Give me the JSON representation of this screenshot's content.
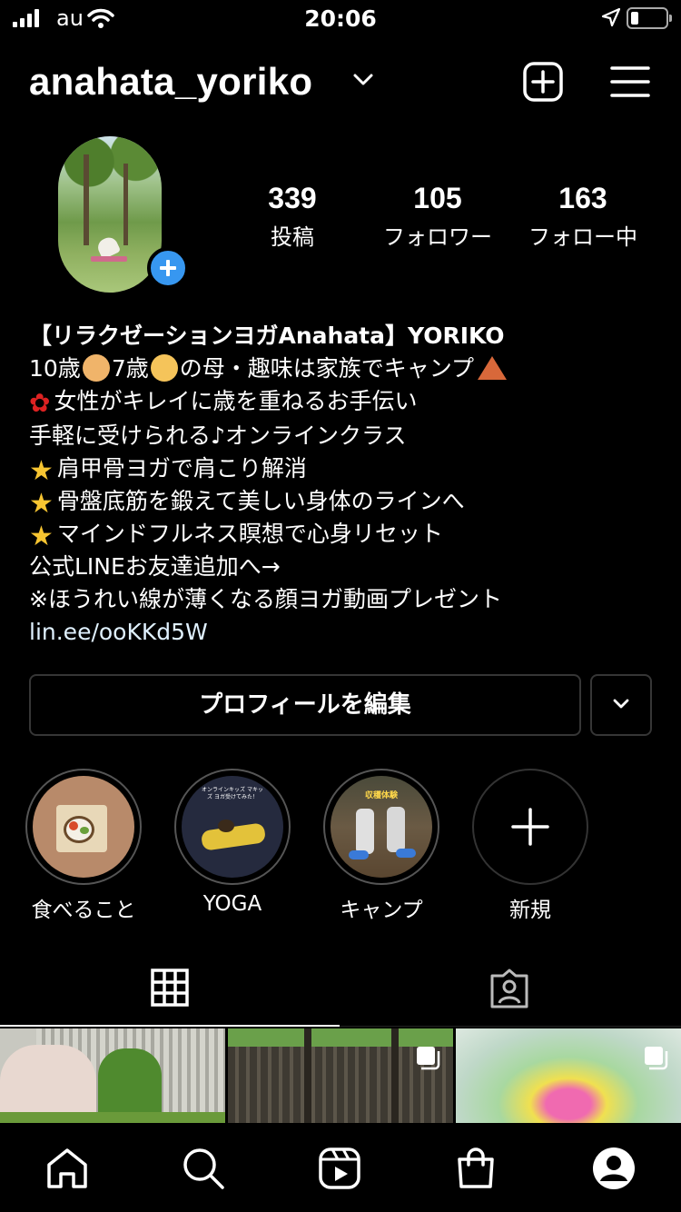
{
  "status_bar": {
    "carrier": "au",
    "time": "20:06"
  },
  "header": {
    "username": "anahata_yoriko"
  },
  "stats": [
    {
      "value": "339",
      "label": "投稿"
    },
    {
      "value": "105",
      "label": "フォロワー"
    },
    {
      "value": "163",
      "label": "フォロー中"
    }
  ],
  "bio": {
    "name": "【リラクゼーションヨガAnahata】YORIKO",
    "line1_a": "10歳",
    "line1_b": "7歳",
    "line1_c": "の母・趣味は家族でキャンプ",
    "line2": "女性がキレイに歳を重ねるお手伝い",
    "line3": "手軽に受けられる♪オンラインクラス",
    "line4": "肩甲骨ヨガで肩こり解消",
    "line5": "骨盤底筋を鍛えて美しい身体のラインへ",
    "line6": "マインドフルネス瞑想で心身リセット",
    "line7": "公式LINEお友達追加へ→",
    "line8": "※ほうれい線が薄くなる顔ヨガ動画プレゼント",
    "link": "lin.ee/ooKKd5W"
  },
  "buttons": {
    "edit_profile": "プロフィールを編集"
  },
  "highlights": [
    {
      "label": "食べること"
    },
    {
      "label": "YOGA",
      "thumb_text": "オンラインキッズ マキッズ ヨガ受けてみた！"
    },
    {
      "label": "キャンプ",
      "thumb_text": "収穫体験"
    },
    {
      "label": "新規"
    }
  ],
  "tabs": {
    "active": "grid"
  },
  "bottom_nav": {
    "active": "profile"
  },
  "colors": {
    "background": "#000000",
    "accent_blue": "#3797f0",
    "border": "#363636",
    "link": "#e0f1ff"
  },
  "icons": [
    "signal-icon",
    "wifi-icon",
    "location-arrow-icon",
    "battery-icon",
    "chevron-down-icon",
    "new-post-icon",
    "hamburger-menu-icon",
    "plus-icon",
    "grid-icon",
    "tagged-icon",
    "multiple-posts-icon",
    "home-icon",
    "search-icon",
    "reels-icon",
    "shop-icon",
    "profile-icon"
  ]
}
